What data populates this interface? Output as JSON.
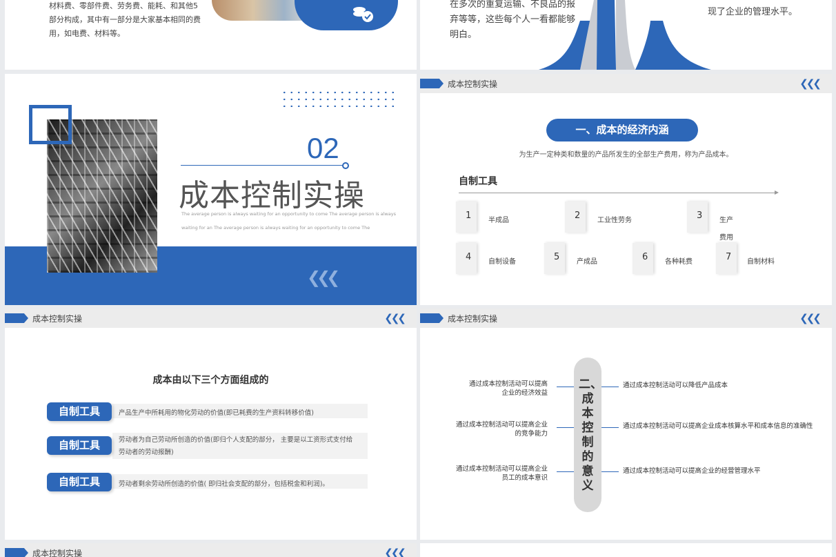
{
  "slide1": {
    "text_lines": [
      "材料费、零部件费、劳务费、能耗、和其他5",
      "部分构成，其中有一部分是大家基本相同的费",
      "用，如电费、材料等。"
    ]
  },
  "slide2": {
    "text_lines": [
      "在多次的重复运输、不良品的报",
      "弃等等，这些每个人一看都能够",
      "明白。"
    ],
    "right_lines": [
      "现了企业的管理水平。"
    ]
  },
  "slide3": {
    "number": "02",
    "title": "成本控制实操",
    "subtitle_lines": [
      "The average person is always waiting for an opportunity to come The average person is always",
      "waiting for an The average person is always waiting for an opportunity to come The"
    ]
  },
  "slide4": {
    "header": "成本控制实操",
    "pill": "一、成本的经济内涵",
    "desc": "为生产一定种类和数量的产品所发生的全部生产费用，称为产品成本。",
    "subheading": "自制工具",
    "items": [
      {
        "num": "1",
        "label": "半成品"
      },
      {
        "num": "2",
        "label": "工业性劳务"
      },
      {
        "num": "3",
        "label": "生产"
      },
      {
        "num": "3",
        "label": "费用"
      },
      {
        "num": "4",
        "label": "自制设备"
      },
      {
        "num": "5",
        "label": "产成品"
      },
      {
        "num": "6",
        "label": "各种耗费"
      },
      {
        "num": "7",
        "label": "自制材料"
      }
    ]
  },
  "slide5": {
    "header": "成本控制实操",
    "title": "成本由以下三个方面组成的",
    "rows": [
      {
        "btn": "自制工具",
        "text1": "产品生产中所耗用的物化劳动的价值(即已耗费的生产资料转移价值)",
        "text2": ""
      },
      {
        "btn": "自制工具",
        "text1": "劳动者为自己劳动所创造的价值(即归个人支配的部分，  主要是以工资形式支付给",
        "text2": "劳动者的劳动报酬)"
      },
      {
        "btn": "自制工具",
        "text1": "劳动者剩余劳动所创造的价值( 即归社会支配的部分，包括税金和利润)。",
        "text2": ""
      }
    ]
  },
  "slide6": {
    "header": "成本控制实操",
    "center_title": "二、成本控制的意义",
    "left": [
      [
        "通过成本控制活动可以提高",
        "企业的经济效益"
      ],
      [
        "通过成本控制活动可以提高企业",
        "的竞争能力"
      ],
      [
        "通过成本控制活动可以提高企业",
        "员工的成本意识"
      ]
    ],
    "right": [
      "通过成本控制活动可以降低产品成本",
      "通过成本控制活动可以提高企业成本核算水平和成本信息的准确性",
      "通过成本控制活动可以提高企业的经营管理水平"
    ]
  },
  "slide7": {
    "header": "成本控制实操"
  },
  "colors": {
    "accent": "#2d67b8",
    "header_bg": "#ececec",
    "pill_gray": "#e2e2e2"
  }
}
